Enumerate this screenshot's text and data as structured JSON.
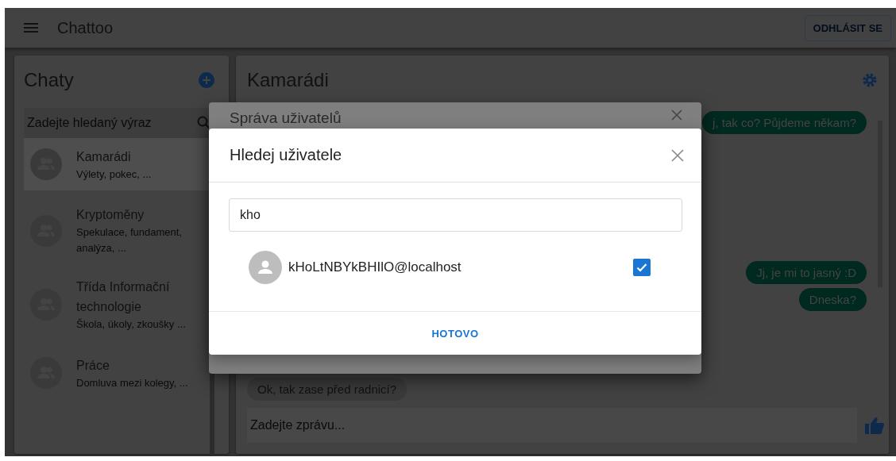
{
  "app_bar": {
    "title": "Chattoo",
    "logout_button": "ODHLÁSIT SE"
  },
  "chats_panel": {
    "title": "Chaty",
    "search": {
      "placeholder": "Zadejte hledaný výraz"
    },
    "items": [
      {
        "name": "Kamarádi",
        "description": "Výlety, pokec, ...",
        "selected": true
      },
      {
        "name": "Kryptoměny",
        "description": "Spekulace, fundament, analýza, ...",
        "selected": false
      },
      {
        "name": "Třída Informační technologie",
        "description": "Škola, úkoly, zkoušky ...",
        "selected": false
      },
      {
        "name": "Práce",
        "description": "Domluva mezi kolegy, ...",
        "selected": false
      }
    ]
  },
  "chat": {
    "title": "Kamarádi",
    "messages": [
      {
        "text": "j, tak co? Půjdeme někam?",
        "outgoing": true
      },
      {
        "text": "Jj, je mi to jasný :D",
        "outgoing": true
      },
      {
        "text": "Dneska?",
        "outgoing": true
      },
      {
        "text": "Ok, tak zase před radnicí?",
        "outgoing": false
      }
    ],
    "composer": {
      "placeholder": "Zadejte zprávu..."
    }
  },
  "background_dialog": {
    "title": "Správa uživatelů"
  },
  "dialog": {
    "title": "Hledej uživatele",
    "search": {
      "value": "kho"
    },
    "results": [
      {
        "name": "kHoLtNBYkBHIlO@localhost",
        "checked": true
      }
    ],
    "done_button": "HOTOVO"
  }
}
